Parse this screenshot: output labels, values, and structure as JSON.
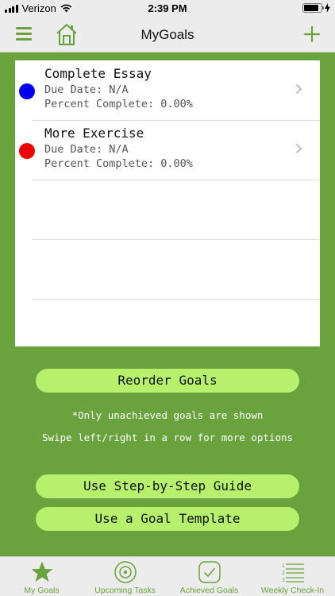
{
  "status_bar": {
    "carrier": "Verizon",
    "time": "2:39 PM"
  },
  "nav": {
    "title": "MyGoals",
    "menu_icon": "hamburger-menu-icon",
    "home_icon": "home-icon",
    "add_icon": "plus-icon"
  },
  "goals": [
    {
      "title": "Complete Essay",
      "due_date": "Due Date: N/A",
      "percent": "Percent Complete: 0.00%",
      "color": "#0000ee"
    },
    {
      "title": "More Exercise",
      "due_date": "Due Date: N/A",
      "percent": "Percent Complete: 0.00%",
      "color": "#ee0000"
    }
  ],
  "actions": {
    "reorder": "Reorder Goals",
    "note_unachieved": "*Only unachieved goals are shown",
    "note_swipe": "Swipe left/right in a row for more options",
    "step_guide": "Use Step-by-Step Guide",
    "template": "Use a Goal Template"
  },
  "tabs": [
    {
      "label": "My Goals",
      "icon": "star-icon",
      "selected": true
    },
    {
      "label": "Upcoming Tasks",
      "icon": "target-icon",
      "selected": false
    },
    {
      "label": "Achieved Goals",
      "icon": "checkmark-icon",
      "selected": false
    },
    {
      "label": "Weekly Check-In",
      "icon": "numbered-list-icon",
      "selected": false
    }
  ],
  "colors": {
    "brand_green": "#6aa33d",
    "button_green": "#b6f06c",
    "bar_gray": "#ececec"
  }
}
